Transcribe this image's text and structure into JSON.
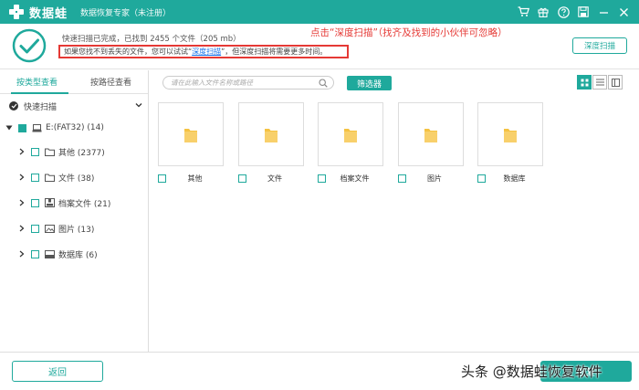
{
  "colors": {
    "accent": "#1fa99c",
    "annotation": "#e53935",
    "link": "#1a73e8",
    "folder": "#f5c242"
  },
  "titlebar": {
    "logo_text": "数据蛙",
    "app_title": "数据恢复专家（未注册）",
    "icons": [
      "cart-icon",
      "gift-icon",
      "help-icon",
      "save-icon",
      "minimize-icon",
      "close-icon"
    ]
  },
  "header": {
    "status": "快速扫描已完成，已找到 2455 个文件（205 mb）",
    "hint_prefix": "如果您找不到丢失的文件，您可以试试“",
    "hint_link": "深度扫描",
    "hint_suffix": "”，但深度扫描将需要更多时间。",
    "annotation": "点击“深度扫描”（找齐及找到的小伙伴可忽略）",
    "deep_scan_button": "深度扫描"
  },
  "sidebar": {
    "tabs": [
      "按类型查看",
      "按路径查看"
    ],
    "quick_scan": "快速扫描",
    "drive": "E:(FAT32) (14)",
    "items": [
      {
        "label": "其他 (2377)",
        "icon": "folder-outline-icon"
      },
      {
        "label": "文件 (38)",
        "icon": "folder-outline-icon"
      },
      {
        "label": "档案文件 (21)",
        "icon": "archive-icon"
      },
      {
        "label": "图片 (13)",
        "icon": "image-icon"
      },
      {
        "label": "数据库 (6)",
        "icon": "database-icon"
      }
    ]
  },
  "main": {
    "search_placeholder": "请在此输入文件名称或路径",
    "filter_button": "筛选器",
    "tiles": [
      "其他",
      "文件",
      "档案文件",
      "图片",
      "数据库"
    ]
  },
  "footer": {
    "back_button": "返回",
    "recover_button": "恢复",
    "watermark": "头条 @数据蛙恢复软件"
  }
}
